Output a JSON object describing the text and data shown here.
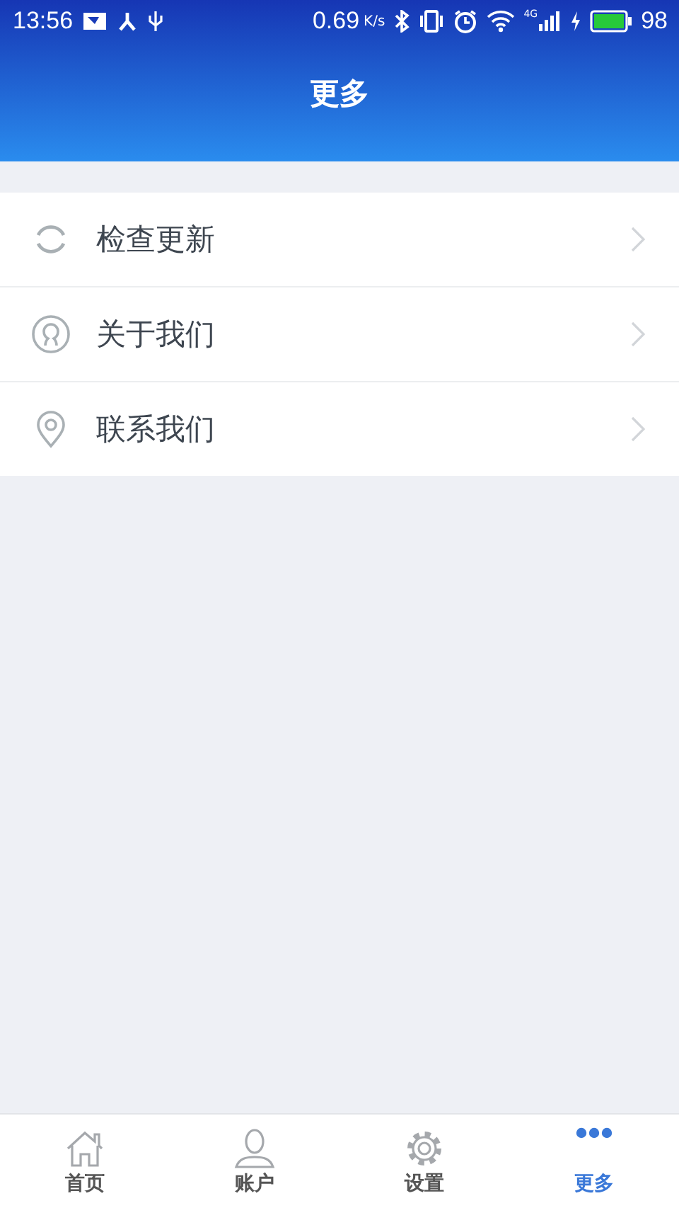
{
  "status_bar": {
    "time": "13:56",
    "speed": "0.69",
    "speed_unit": "K/s",
    "network": "4G",
    "battery": "98"
  },
  "header": {
    "title": "更多"
  },
  "menu": [
    {
      "kind": "refresh",
      "label": "检查更新"
    },
    {
      "kind": "person",
      "label": "关于我们"
    },
    {
      "kind": "location",
      "label": "联系我们"
    }
  ],
  "tabs": [
    {
      "kind": "home",
      "label": "首页",
      "selected": false
    },
    {
      "kind": "account",
      "label": "账户",
      "selected": false
    },
    {
      "kind": "settings",
      "label": "设置",
      "selected": false
    },
    {
      "kind": "more",
      "label": "更多",
      "selected": true
    }
  ]
}
